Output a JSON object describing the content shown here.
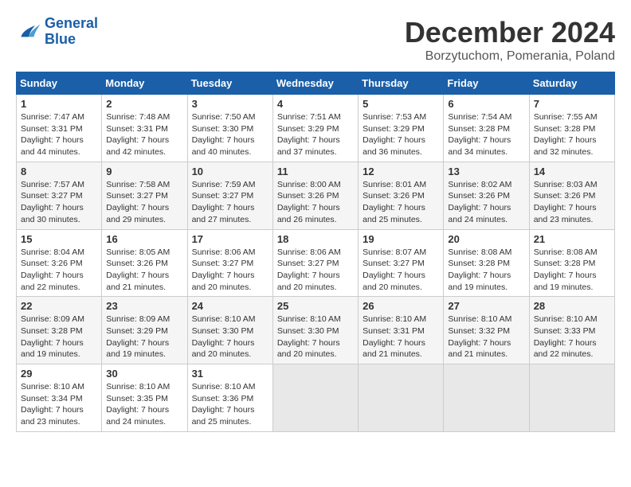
{
  "logo": {
    "line1": "General",
    "line2": "Blue"
  },
  "title": "December 2024",
  "location": "Borzytuchom, Pomerania, Poland",
  "days_of_week": [
    "Sunday",
    "Monday",
    "Tuesday",
    "Wednesday",
    "Thursday",
    "Friday",
    "Saturday"
  ],
  "weeks": [
    [
      {
        "day": "1",
        "sunrise": "Sunrise: 7:47 AM",
        "sunset": "Sunset: 3:31 PM",
        "daylight": "Daylight: 7 hours and 44 minutes."
      },
      {
        "day": "2",
        "sunrise": "Sunrise: 7:48 AM",
        "sunset": "Sunset: 3:31 PM",
        "daylight": "Daylight: 7 hours and 42 minutes."
      },
      {
        "day": "3",
        "sunrise": "Sunrise: 7:50 AM",
        "sunset": "Sunset: 3:30 PM",
        "daylight": "Daylight: 7 hours and 40 minutes."
      },
      {
        "day": "4",
        "sunrise": "Sunrise: 7:51 AM",
        "sunset": "Sunset: 3:29 PM",
        "daylight": "Daylight: 7 hours and 37 minutes."
      },
      {
        "day": "5",
        "sunrise": "Sunrise: 7:53 AM",
        "sunset": "Sunset: 3:29 PM",
        "daylight": "Daylight: 7 hours and 36 minutes."
      },
      {
        "day": "6",
        "sunrise": "Sunrise: 7:54 AM",
        "sunset": "Sunset: 3:28 PM",
        "daylight": "Daylight: 7 hours and 34 minutes."
      },
      {
        "day": "7",
        "sunrise": "Sunrise: 7:55 AM",
        "sunset": "Sunset: 3:28 PM",
        "daylight": "Daylight: 7 hours and 32 minutes."
      }
    ],
    [
      {
        "day": "8",
        "sunrise": "Sunrise: 7:57 AM",
        "sunset": "Sunset: 3:27 PM",
        "daylight": "Daylight: 7 hours and 30 minutes."
      },
      {
        "day": "9",
        "sunrise": "Sunrise: 7:58 AM",
        "sunset": "Sunset: 3:27 PM",
        "daylight": "Daylight: 7 hours and 29 minutes."
      },
      {
        "day": "10",
        "sunrise": "Sunrise: 7:59 AM",
        "sunset": "Sunset: 3:27 PM",
        "daylight": "Daylight: 7 hours and 27 minutes."
      },
      {
        "day": "11",
        "sunrise": "Sunrise: 8:00 AM",
        "sunset": "Sunset: 3:26 PM",
        "daylight": "Daylight: 7 hours and 26 minutes."
      },
      {
        "day": "12",
        "sunrise": "Sunrise: 8:01 AM",
        "sunset": "Sunset: 3:26 PM",
        "daylight": "Daylight: 7 hours and 25 minutes."
      },
      {
        "day": "13",
        "sunrise": "Sunrise: 8:02 AM",
        "sunset": "Sunset: 3:26 PM",
        "daylight": "Daylight: 7 hours and 24 minutes."
      },
      {
        "day": "14",
        "sunrise": "Sunrise: 8:03 AM",
        "sunset": "Sunset: 3:26 PM",
        "daylight": "Daylight: 7 hours and 23 minutes."
      }
    ],
    [
      {
        "day": "15",
        "sunrise": "Sunrise: 8:04 AM",
        "sunset": "Sunset: 3:26 PM",
        "daylight": "Daylight: 7 hours and 22 minutes."
      },
      {
        "day": "16",
        "sunrise": "Sunrise: 8:05 AM",
        "sunset": "Sunset: 3:26 PM",
        "daylight": "Daylight: 7 hours and 21 minutes."
      },
      {
        "day": "17",
        "sunrise": "Sunrise: 8:06 AM",
        "sunset": "Sunset: 3:27 PM",
        "daylight": "Daylight: 7 hours and 20 minutes."
      },
      {
        "day": "18",
        "sunrise": "Sunrise: 8:06 AM",
        "sunset": "Sunset: 3:27 PM",
        "daylight": "Daylight: 7 hours and 20 minutes."
      },
      {
        "day": "19",
        "sunrise": "Sunrise: 8:07 AM",
        "sunset": "Sunset: 3:27 PM",
        "daylight": "Daylight: 7 hours and 20 minutes."
      },
      {
        "day": "20",
        "sunrise": "Sunrise: 8:08 AM",
        "sunset": "Sunset: 3:28 PM",
        "daylight": "Daylight: 7 hours and 19 minutes."
      },
      {
        "day": "21",
        "sunrise": "Sunrise: 8:08 AM",
        "sunset": "Sunset: 3:28 PM",
        "daylight": "Daylight: 7 hours and 19 minutes."
      }
    ],
    [
      {
        "day": "22",
        "sunrise": "Sunrise: 8:09 AM",
        "sunset": "Sunset: 3:28 PM",
        "daylight": "Daylight: 7 hours and 19 minutes."
      },
      {
        "day": "23",
        "sunrise": "Sunrise: 8:09 AM",
        "sunset": "Sunset: 3:29 PM",
        "daylight": "Daylight: 7 hours and 19 minutes."
      },
      {
        "day": "24",
        "sunrise": "Sunrise: 8:10 AM",
        "sunset": "Sunset: 3:30 PM",
        "daylight": "Daylight: 7 hours and 20 minutes."
      },
      {
        "day": "25",
        "sunrise": "Sunrise: 8:10 AM",
        "sunset": "Sunset: 3:30 PM",
        "daylight": "Daylight: 7 hours and 20 minutes."
      },
      {
        "day": "26",
        "sunrise": "Sunrise: 8:10 AM",
        "sunset": "Sunset: 3:31 PM",
        "daylight": "Daylight: 7 hours and 21 minutes."
      },
      {
        "day": "27",
        "sunrise": "Sunrise: 8:10 AM",
        "sunset": "Sunset: 3:32 PM",
        "daylight": "Daylight: 7 hours and 21 minutes."
      },
      {
        "day": "28",
        "sunrise": "Sunrise: 8:10 AM",
        "sunset": "Sunset: 3:33 PM",
        "daylight": "Daylight: 7 hours and 22 minutes."
      }
    ],
    [
      {
        "day": "29",
        "sunrise": "Sunrise: 8:10 AM",
        "sunset": "Sunset: 3:34 PM",
        "daylight": "Daylight: 7 hours and 23 minutes."
      },
      {
        "day": "30",
        "sunrise": "Sunrise: 8:10 AM",
        "sunset": "Sunset: 3:35 PM",
        "daylight": "Daylight: 7 hours and 24 minutes."
      },
      {
        "day": "31",
        "sunrise": "Sunrise: 8:10 AM",
        "sunset": "Sunset: 3:36 PM",
        "daylight": "Daylight: 7 hours and 25 minutes."
      },
      null,
      null,
      null,
      null
    ]
  ]
}
